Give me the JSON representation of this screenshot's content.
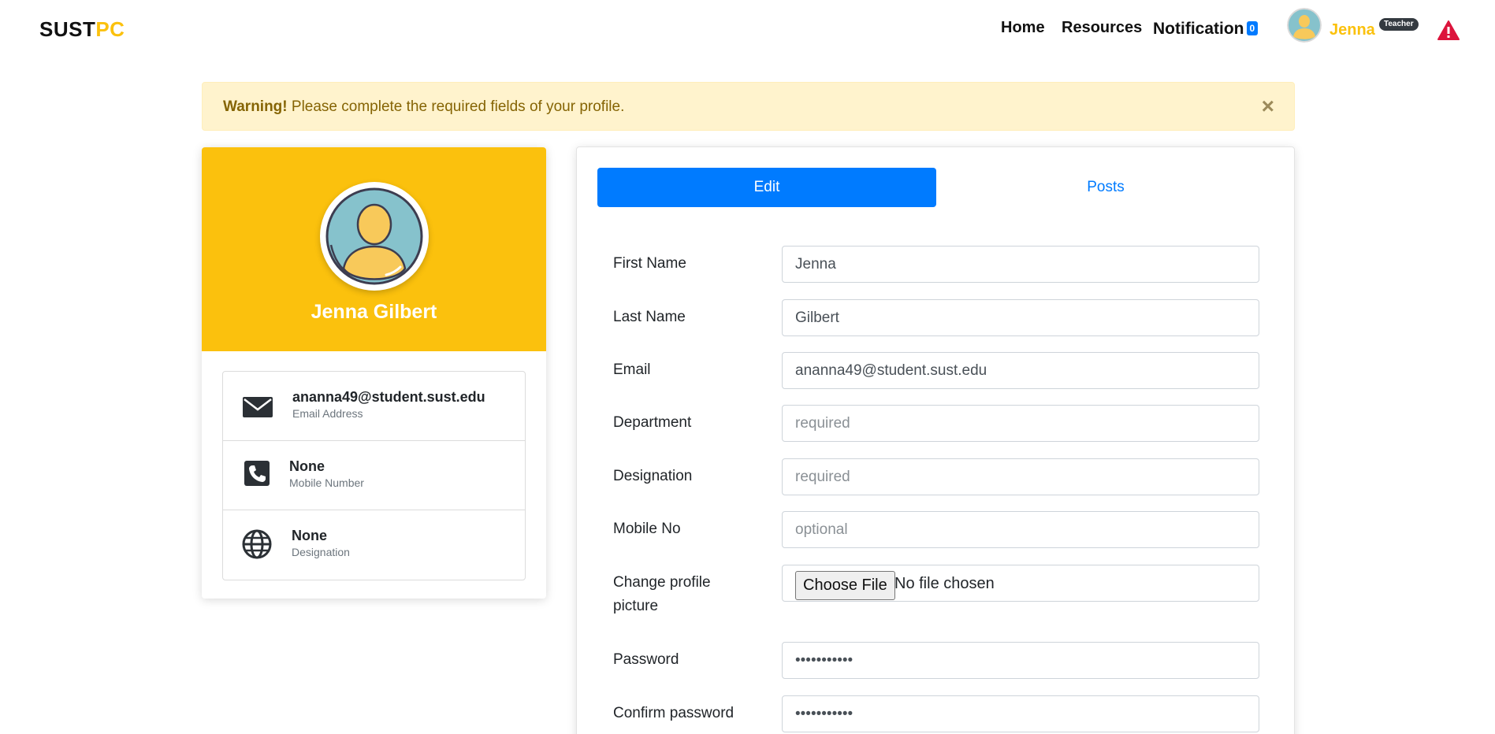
{
  "navbar": {
    "brand_part1": "SUST",
    "brand_part2": "PC",
    "home": "Home",
    "resources": "Resources",
    "notification": "Notification",
    "notification_count": "0",
    "user_name": "Jenna",
    "user_role": "Teacher",
    "alert_icon": "warning-triangle-icon",
    "brand_color": "#fbc10d",
    "alert_color": "#dc143c"
  },
  "warning": {
    "strong": "Warning!",
    "message": " Please complete the required fields of your profile.",
    "close": "×"
  },
  "profile": {
    "name": "Jenna Gilbert",
    "items": [
      {
        "icon": "envelope-icon",
        "value": "ananna49@student.sust.edu",
        "label": "Email Address"
      },
      {
        "icon": "phone-icon",
        "value": "None",
        "label": "Mobile Number"
      },
      {
        "icon": "globe-icon",
        "value": "None",
        "label": "Designation"
      }
    ]
  },
  "tabs": {
    "edit": "Edit",
    "posts": "Posts",
    "active_color": "#007bff"
  },
  "form": {
    "first_name": {
      "label": "First Name",
      "value": "Jenna",
      "placeholder": ""
    },
    "last_name": {
      "label": "Last Name",
      "value": "Gilbert",
      "placeholder": ""
    },
    "email": {
      "label": "Email",
      "value": "ananna49@student.sust.edu",
      "placeholder": ""
    },
    "department": {
      "label": "Department",
      "value": "",
      "placeholder": "required"
    },
    "designation": {
      "label": "Designation",
      "value": "",
      "placeholder": "required"
    },
    "mobile": {
      "label": "Mobile No",
      "value": "",
      "placeholder": "optional"
    },
    "picture": {
      "label": "Change profile picture",
      "button": "Choose File",
      "status": "No file chosen"
    },
    "password": {
      "label": "Password",
      "value": "•••••••••••"
    },
    "confirm_password": {
      "label": "Confirm password",
      "value": "•••••••••••"
    }
  }
}
